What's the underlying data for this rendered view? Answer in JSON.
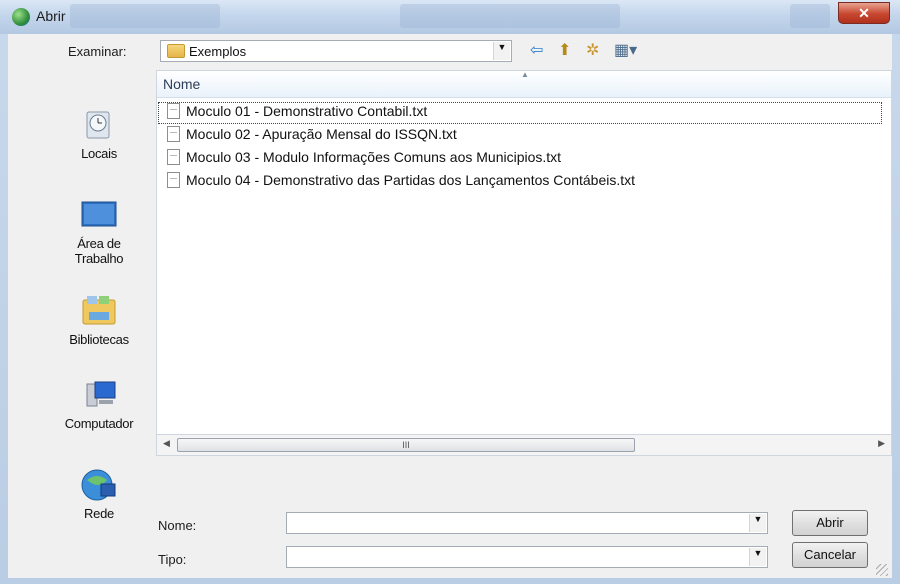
{
  "window": {
    "title": "Abrir",
    "close_glyph": "✕"
  },
  "toolbar": {
    "look_in_label": "Examinar:",
    "look_in_value": "Exemplos",
    "icons": [
      "back-arrow-icon",
      "up-folder-icon",
      "new-folder-icon",
      "view-menu-icon"
    ]
  },
  "places": [
    {
      "name": "Locais",
      "icon": "recent-places-icon"
    },
    {
      "name": "Área de Trabalho",
      "icon": "desktop-icon"
    },
    {
      "name": "Bibliotecas",
      "icon": "libraries-icon"
    },
    {
      "name": "Computador",
      "icon": "computer-icon"
    },
    {
      "name": "Rede",
      "icon": "network-icon"
    }
  ],
  "file_list": {
    "column_header": "Nome",
    "files": [
      "Moculo 01 - Demonstrativo Contabil.txt",
      "Moculo 02 - Apuração Mensal do ISSQN.txt",
      "Moculo 03 - Modulo Informações Comuns aos Municipios.txt",
      "Moculo 04 - Demonstrativo das Partidas dos Lançamentos Contábeis.txt"
    ]
  },
  "scrollbar": {
    "thumb_glyph": "III"
  },
  "footer": {
    "name_label": "Nome:",
    "name_value": "",
    "type_label": "Tipo:",
    "type_value": "",
    "open_label": "Abrir",
    "cancel_label": "Cancelar"
  },
  "colors": {
    "title_gradient_top": "#dbe7f5",
    "close_button": "#c8472f",
    "header_text": "#2c3e55"
  }
}
